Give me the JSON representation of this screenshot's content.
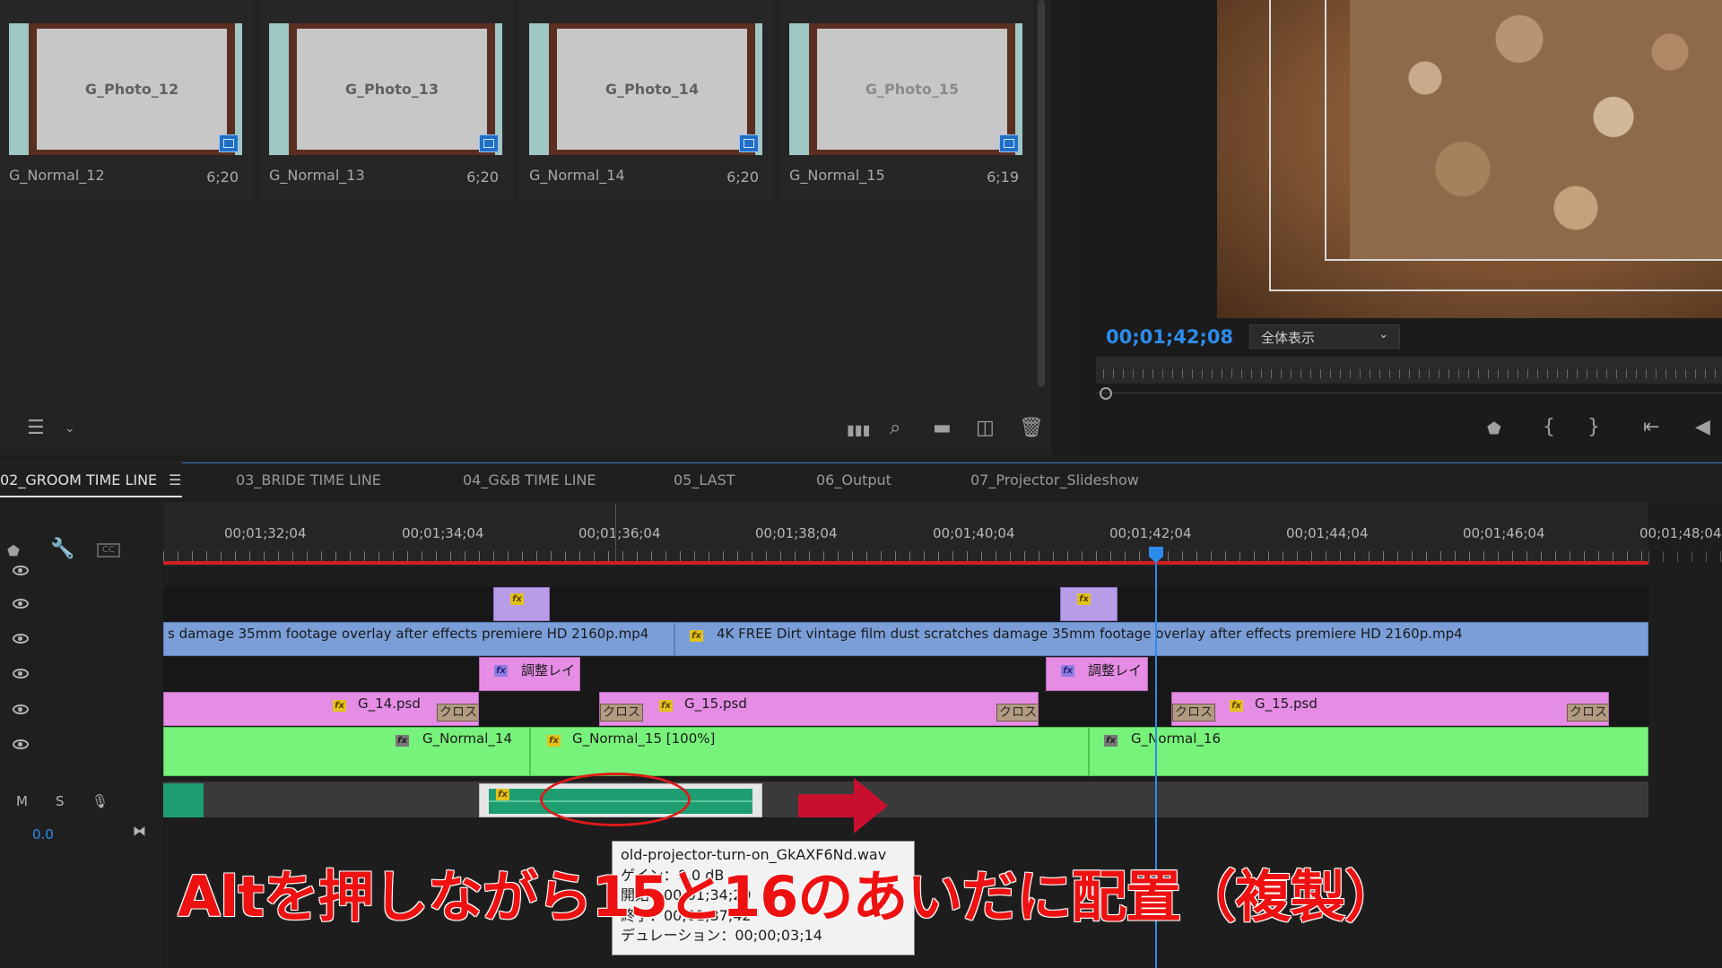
{
  "project_panel": {
    "thumbnails": [
      {
        "title": "G_Photo_12",
        "name": "G_Normal_12",
        "duration": "6;20"
      },
      {
        "title": "G_Photo_13",
        "name": "G_Normal_13",
        "duration": "6;20"
      },
      {
        "title": "G_Photo_14",
        "name": "G_Normal_14",
        "duration": "6;20"
      },
      {
        "title": "G_Photo_15",
        "name": "G_Normal_15",
        "duration": "6;19"
      }
    ]
  },
  "program_monitor": {
    "timecode": "00;01;42;08",
    "fit_label": "全体表示"
  },
  "timeline": {
    "tabs": [
      "02_GROOM TIME LINE",
      "03_BRIDE TIME LINE",
      "04_G&B TIME LINE",
      "05_LAST",
      "06_Output",
      "07_Projector_Slideshow"
    ],
    "timecodes": [
      "00;01;32;04",
      "00;01;34;04",
      "00;01;36;04",
      "00;01;38;04",
      "00;01;40;04",
      "00;01;42;04",
      "00;01;44;04",
      "00;01;46;04",
      "00;01;48;04"
    ],
    "clips": {
      "overlay_left": "s damage 35mm footage overlay after effects premiere HD 2160p.mp4",
      "overlay_right": "4K FREE Dirt vintage film dust scratches damage 35mm footage overlay after effects premiere HD 2160p.mp4",
      "adjust_1": "調整レイ",
      "adjust_2": "調整レイ",
      "psd_14": "G_14.psd",
      "psd_15a": "G_15.psd",
      "psd_15b": "G_15.psd",
      "cross_label": "クロス",
      "normal_14": "G_Normal_14",
      "normal_15": "G_Normal_15 [100%]",
      "normal_16": "G_Normal_16"
    },
    "audio": {
      "m": "M",
      "s": "S",
      "volume": "0.0"
    }
  },
  "tooltip": {
    "filename": "old-projector-turn-on_GkAXF6Nd.wav",
    "gain": "ゲイン：0.0 dB",
    "start": "開始：00;01;34;29",
    "end": "終了：00;01;37;42",
    "duration": "デュレーション：00;00;03;14"
  },
  "annotation": "Altを押しながら15と16のあいだに配置（複製）",
  "colors": {
    "accent_blue": "#2d8ceb",
    "annotation_red": "#ee1111",
    "video_clip": "#7a9ed8",
    "graphic_clip": "#e58ce5",
    "normal_clip": "#77f27a",
    "audio_clip": "#1e9e70",
    "adjust_clip": "#b79de8"
  }
}
